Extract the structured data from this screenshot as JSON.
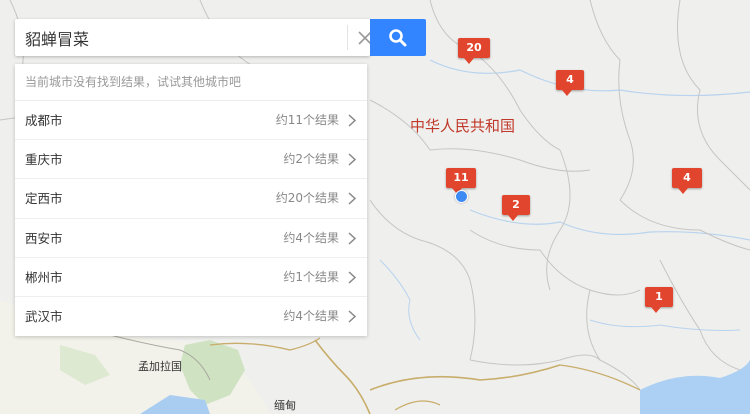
{
  "search": {
    "query": "貂蝉冒菜",
    "placeholder": ""
  },
  "results": {
    "notice": "当前城市没有找到结果，试试其他城市吧",
    "cities": [
      {
        "name": "成都市",
        "count": "约11个结果"
      },
      {
        "name": "重庆市",
        "count": "约2个结果"
      },
      {
        "name": "定西市",
        "count": "约20个结果"
      },
      {
        "name": "西安市",
        "count": "约4个结果"
      },
      {
        "name": "郴州市",
        "count": "约1个结果"
      },
      {
        "name": "武汉市",
        "count": "约4个结果"
      }
    ]
  },
  "map": {
    "country_label": "中华人民共和国",
    "labels": {
      "bangladesh": "孟加拉国",
      "myanmar": "缅甸"
    },
    "markers": {
      "dingxi": "20",
      "xian": "4",
      "chengdu": "11",
      "chongqing": "2",
      "wuhan": "4",
      "chenzhou": "1"
    }
  },
  "colors": {
    "accent": "#3385ff",
    "marker": "#e2452d",
    "country_label": "#c0392b"
  }
}
